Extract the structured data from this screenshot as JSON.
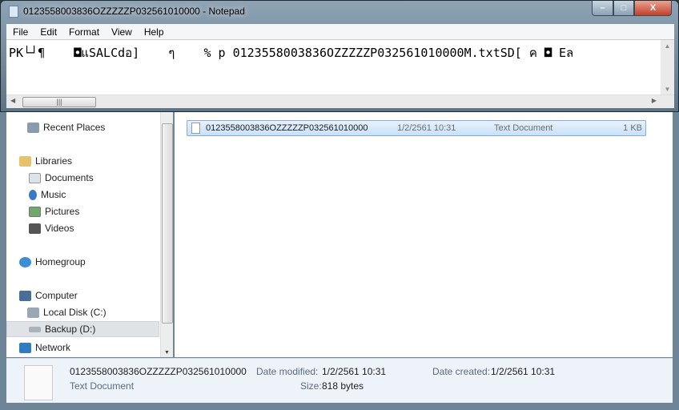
{
  "notepad": {
    "title": "0123558003836OZZZZZP032561010000 - Notepad",
    "menu": [
      "File",
      "Edit",
      "Format",
      "View",
      "Help"
    ],
    "content": "PK└┘¶    ◘แSALCdอ]    ๆ    % p 0123558003836OZZZZZP032561010000M.txtSD[ ค ◘ Eล",
    "buttons": {
      "minimize": "–",
      "maximize": "□",
      "close": "X"
    }
  },
  "nav": {
    "items": [
      "Recent Places",
      "Libraries",
      "Documents",
      "Music",
      "Pictures",
      "Videos",
      "Homegroup",
      "Computer",
      "Local Disk (C:)",
      "Backup (D:)",
      "Network"
    ],
    "selected": "Backup (D:)"
  },
  "file": {
    "name": "0123558003836OZZZZZP032561010000",
    "date": "1/2/2561 10:31",
    "type": "Text Document",
    "size": "1 KB"
  },
  "details": {
    "name": "0123558003836OZZZZZP032561010000",
    "type": "Text Document",
    "modified_label": "Date modified:",
    "modified": "1/2/2561 10:31",
    "created_label": "Date created:",
    "created": "1/2/2561 10:31",
    "size_label": "Size:",
    "size": "818 bytes"
  }
}
